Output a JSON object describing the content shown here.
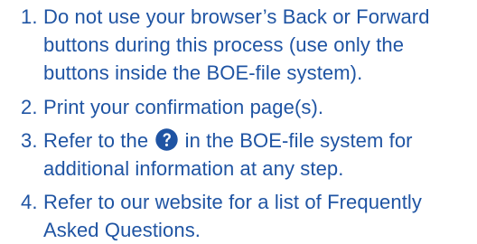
{
  "instructions": [
    {
      "number": "1.",
      "lines": [
        "Do not use your browser’s Back or Forward",
        "buttons during this process (use only the",
        "buttons inside the BOE-file system)."
      ]
    },
    {
      "number": "2.",
      "lines": [
        "Print your confirmation page(s)."
      ]
    },
    {
      "number": "3.",
      "line1_before_icon": "Refer to the",
      "line1_after_icon": "in the BOE-file system for",
      "line2": "additional information at any step."
    },
    {
      "number": "4.",
      "lines": [
        "Refer to our website for a list of Frequently",
        "Asked Questions."
      ]
    }
  ],
  "icons": {
    "help": "question-mark-circle-icon"
  },
  "colors": {
    "text": "#1f54a3",
    "icon_fill": "#1f54a3",
    "icon_glyph": "#ffffff"
  }
}
